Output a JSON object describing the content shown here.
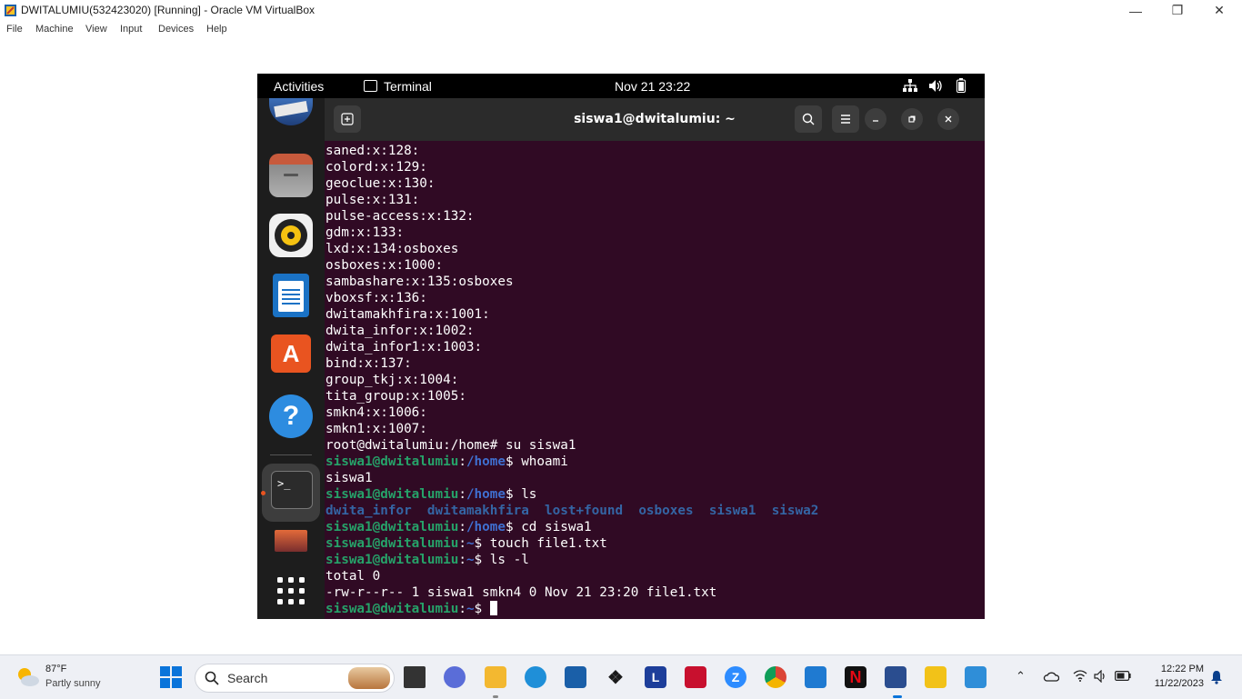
{
  "host_window": {
    "title": "DWITALUMIU(532423020) [Running] - Oracle VM VirtualBox",
    "controls": {
      "minimize": "—",
      "restore": "❐",
      "close": "✕"
    },
    "menu": [
      "File",
      "Machine",
      "View",
      "Input",
      "Devices",
      "Help"
    ]
  },
  "guest": {
    "topbar": {
      "activities": "Activities",
      "app_label": "Terminal",
      "clock": "Nov 21  23:22"
    },
    "dock": {
      "items": [
        "Thunderbird Mail",
        "Files",
        "Rhythmbox",
        "LibreOffice Writer",
        "Ubuntu Software",
        "Help",
        "Terminal",
        "Screenshot",
        "Show Applications"
      ]
    },
    "terminal": {
      "title": "siswa1@dwitalumiu: ~",
      "plain_lines": [
        "saned:x:128:",
        "colord:x:129:",
        "geoclue:x:130:",
        "pulse:x:131:",
        "pulse-access:x:132:",
        "gdm:x:133:",
        "lxd:x:134:osboxes",
        "osboxes:x:1000:",
        "sambashare:x:135:osboxes",
        "vboxsf:x:136:",
        "dwitamakhfira:x:1001:",
        "dwita_infor:x:1002:",
        "dwita_infor1:x:1003:",
        "bind:x:137:",
        "group_tkj:x:1004:",
        "tita_group:x:1005:",
        "smkn4:x:1006:",
        "smkn1:x:1007:",
        "root@dwitalumiu:/home# su siswa1"
      ],
      "prompt_user": "siswa1@dwitalumiu",
      "prompt_sep": ":",
      "session": [
        {
          "path": "/home",
          "cmd": "$ whoami"
        },
        {
          "output": "siswa1"
        },
        {
          "path": "/home",
          "cmd": "$ ls"
        },
        {
          "dirs": [
            "dwita_infor",
            "dwitamakhfira",
            "lost+found",
            "osboxes",
            "siswa1",
            "siswa2"
          ]
        },
        {
          "path": "/home",
          "cmd": "$ cd siswa1"
        },
        {
          "path": "~",
          "cmd": "$ touch file1.txt"
        },
        {
          "path": "~",
          "cmd": "$ ls -l"
        },
        {
          "output": "total 0"
        },
        {
          "output": "-rw-r--r-- 1 siswa1 smkn4 0 Nov 21 23:20 file1.txt"
        }
      ],
      "final_prompt": {
        "path": "~",
        "cmd": "$ "
      }
    }
  },
  "taskbar": {
    "weather": {
      "temp": "87°F",
      "desc": "Partly sunny"
    },
    "search_label": "Search",
    "time": "12:22 PM",
    "date": "11/22/2023"
  }
}
